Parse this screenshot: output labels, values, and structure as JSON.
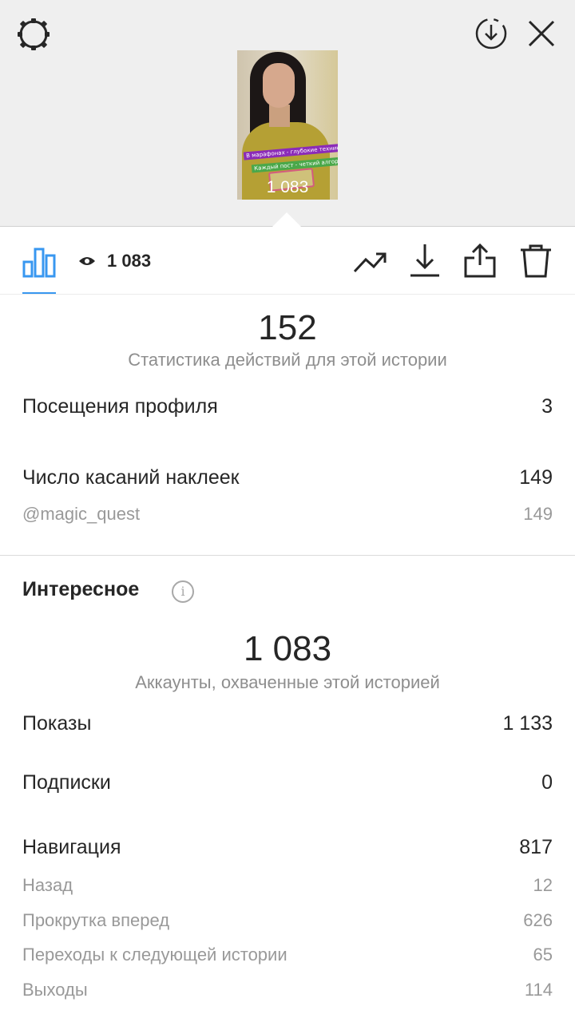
{
  "header": {
    "story_views": "1083"
  },
  "thumbnail": {
    "sticker1": "В марафонах - глубокие техники",
    "sticker2": "Каждый пост - четкий алгоритм",
    "view_count_overlay": "1 083"
  },
  "tabs": {
    "views_count": "1 083"
  },
  "actions": {
    "total": "152",
    "caption": "Статистика действий для этой истории",
    "rows": [
      {
        "label": "Посещения профиля",
        "value": "3"
      },
      {
        "label": "Число касаний наклеек",
        "value": "149"
      },
      {
        "label": "@magic_quest",
        "value": "149"
      }
    ]
  },
  "discovery": {
    "title": "Интересное",
    "reach": "1 083",
    "caption": "Аккаунты, охваченные этой историей",
    "rows": [
      {
        "label": "Показы",
        "value": "1 133"
      },
      {
        "label": "Подписки",
        "value": "0"
      },
      {
        "label": "Навигация",
        "value": "817"
      },
      {
        "label": "Назад",
        "value": "12"
      },
      {
        "label": "Прокрутка вперед",
        "value": "626"
      },
      {
        "label": "Переходы к следующей истории",
        "value": "65"
      },
      {
        "label": "Выходы",
        "value": "114"
      }
    ]
  },
  "colors": {
    "accent": "#3897f0",
    "header_bg": "#efefef",
    "text": "#262626",
    "muted": "#8e8e8e"
  },
  "icons": [
    "settings-gear-icon",
    "download-circle-icon",
    "close-icon",
    "bar-chart-icon",
    "eye-icon",
    "trend-icon",
    "download-icon",
    "share-icon",
    "trash-icon",
    "info-icon"
  ]
}
